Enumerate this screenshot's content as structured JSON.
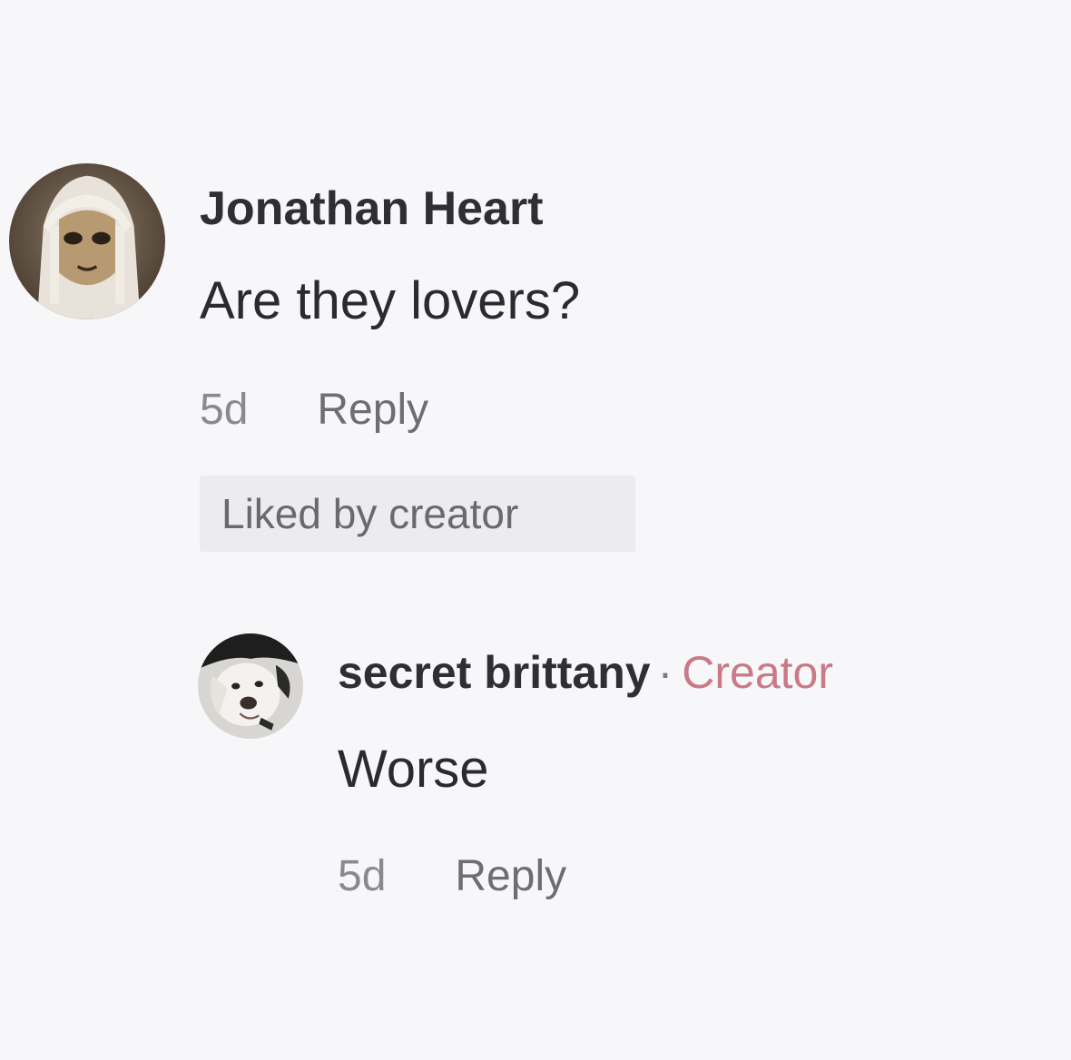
{
  "comments": [
    {
      "username": "Jonathan Heart",
      "text": "Are they lovers?",
      "time": "5d",
      "reply_label": "Reply",
      "liked_badge": "Liked by creator",
      "avatar_icon": "masked-figure-avatar"
    }
  ],
  "reply": {
    "username": "secret brittany",
    "separator": "·",
    "badge": "Creator",
    "text": "Worse",
    "time": "5d",
    "reply_label": "Reply",
    "avatar_icon": "dog-avatar"
  },
  "colors": {
    "background": "#f7f7f9",
    "text": "#2b2b2d",
    "muted": "#6f6f73",
    "creator_badge": "#c97a86",
    "liked_badge_bg": "#ececee"
  }
}
